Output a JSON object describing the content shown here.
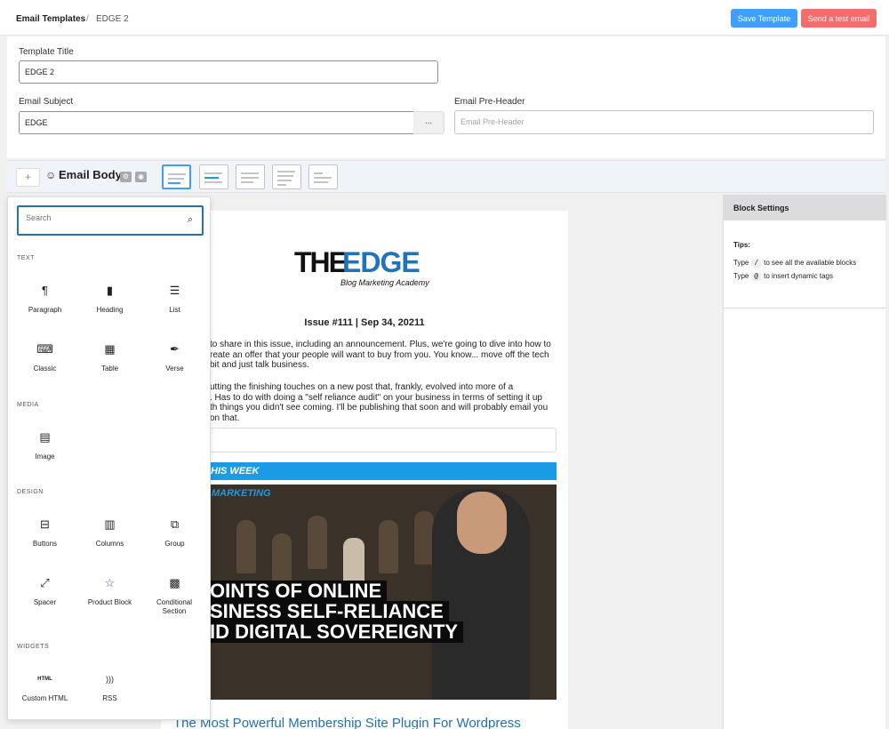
{
  "breadcrumb": {
    "root": "Email Templates",
    "separator": "/",
    "current": "EDGE 2"
  },
  "actions": {
    "save": "Save Template",
    "test": "Send a test email"
  },
  "colors": {
    "primary": "#409eff",
    "danger": "#f56c6c",
    "accent_blue": "#1b9be6",
    "link": "#2271b1"
  },
  "form": {
    "title_label": "Template Title",
    "title_value": "EDGE 2",
    "subject_label": "Email Subject",
    "subject_value": "EDGE",
    "subject_more": "...",
    "preheader_label": "Email Pre-Header",
    "preheader_placeholder": "Email Pre-Header"
  },
  "editor": {
    "add_icon": "+",
    "body_icon": "smiley-icon",
    "body_title": "Email Body",
    "icons": [
      "settings-icon",
      "preview-eye-icon"
    ],
    "layout_count": 5
  },
  "inserter": {
    "search_placeholder": "Search",
    "categories": [
      {
        "label": "TEXT",
        "blocks": [
          {
            "label": "Paragraph",
            "icon": "¶"
          },
          {
            "label": "Heading",
            "icon": "🔖"
          },
          {
            "label": "List",
            "icon": "☰"
          },
          {
            "label": "Classic",
            "icon": "⌨"
          },
          {
            "label": "Table",
            "icon": "▦"
          },
          {
            "label": "Verse",
            "icon": "✒"
          }
        ]
      },
      {
        "label": "MEDIA",
        "blocks": [
          {
            "label": "Image",
            "icon": "🖼"
          }
        ]
      },
      {
        "label": "DESIGN",
        "blocks": [
          {
            "label": "Buttons",
            "icon": "⊟"
          },
          {
            "label": "Columns",
            "icon": "▥"
          },
          {
            "label": "Group",
            "icon": "⧉"
          },
          {
            "label": "Spacer",
            "icon": "⤢"
          },
          {
            "label": "Product Block",
            "icon": "☆"
          },
          {
            "label": "Conditional Section",
            "icon": "▩"
          }
        ]
      },
      {
        "label": "WIDGETS",
        "blocks": [
          {
            "label": "Custom HTML",
            "icon": "HTML"
          },
          {
            "label": "RSS",
            "icon": ")))"
          }
        ]
      }
    ]
  },
  "email": {
    "logo_the": "THE",
    "logo_edge": "EDGE",
    "logo_sub": "Blog Marketing Academy",
    "issue": "Issue #111 | Sep 34, 20211",
    "p1": [
      "to share in this issue, including an announcement. Plus, we're going to dive into how to",
      "reate an offer that your people will want to buy from you. You know... move off the tech",
      "bit and just talk business."
    ],
    "p2": [
      "utting the finishing touches on a new post that, frankly, evolved into more of a",
      ". Has to do with doing a \"self reliance audit\" on your business in terms of setting it up",
      "th things you didn't see coming. I'll be publishing that soon and will probably email you",
      "on that."
    ],
    "week_heading": "HIS WEEK",
    "video_brand": "MARKETING",
    "video_lines": [
      "OINTS OF ONLINE",
      "SINESS SELF-RELIANCE",
      "ID DIGITAL SOVEREIGNTY"
    ],
    "post_title": "The Most Powerful Membership Site Plugin For Wordpress"
  },
  "settings_panel": {
    "title": "Block Settings",
    "tips_label": "Tips:",
    "tip1_pre": "Type",
    "tip1_key": "/",
    "tip1_post": "to see all the available blocks",
    "tip2_pre": "Type",
    "tip2_key": "@",
    "tip2_post": "to insert dynamic tags"
  }
}
